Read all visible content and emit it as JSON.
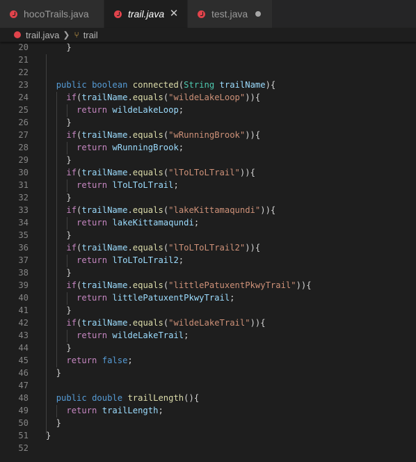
{
  "tabs": [
    {
      "label": "hocoTrails.java",
      "active": false,
      "state": "none"
    },
    {
      "label": "trail.java",
      "active": true,
      "state": "close"
    },
    {
      "label": "test.java",
      "active": false,
      "state": "dirty"
    }
  ],
  "breadcrumb": {
    "file": "trail.java",
    "symbol": "trail"
  },
  "colors": {
    "keyword": "#569cd6",
    "function": "#dcdcaa",
    "string": "#ce9178",
    "type": "#4ec9b0",
    "variable": "#9cdcfe",
    "control": "#c586c0",
    "text": "#d4d4d4",
    "line_number": "#858585",
    "java_icon": "#e0434b"
  },
  "lines": [
    {
      "n": "20",
      "tokens": [
        [
          "    }",
          ""
        ]
      ]
    },
    {
      "n": "21",
      "tokens": []
    },
    {
      "n": "22",
      "tokens": []
    },
    {
      "n": "23",
      "tokens": [
        [
          "  ",
          ""
        ],
        [
          "public",
          "k"
        ],
        [
          " ",
          ""
        ],
        [
          "boolean",
          "k"
        ],
        [
          " ",
          ""
        ],
        [
          "connected",
          "f"
        ],
        [
          "(",
          ""
        ],
        [
          "String",
          "t"
        ],
        [
          " ",
          ""
        ],
        [
          "trailName",
          "v"
        ],
        [
          "){",
          ""
        ]
      ]
    },
    {
      "n": "24",
      "tokens": [
        [
          "    ",
          ""
        ],
        [
          "if",
          "c"
        ],
        [
          "(",
          ""
        ],
        [
          "trailName",
          "v"
        ],
        [
          ".",
          ""
        ],
        [
          "equals",
          "f"
        ],
        [
          "(",
          ""
        ],
        [
          "\"wildeLakeLoop\"",
          "s"
        ],
        ")){"
      ]
    },
    {
      "n": "25",
      "tokens": [
        [
          "      ",
          ""
        ],
        [
          "return",
          "c"
        ],
        [
          " ",
          ""
        ],
        [
          "wildeLakeLoop",
          "v"
        ],
        [
          ";",
          ""
        ]
      ]
    },
    {
      "n": "26",
      "tokens": [
        [
          "    }",
          ""
        ]
      ]
    },
    {
      "n": "27",
      "tokens": [
        [
          "    ",
          ""
        ],
        [
          "if",
          "c"
        ],
        [
          "(",
          ""
        ],
        [
          "trailName",
          "v"
        ],
        [
          ".",
          ""
        ],
        [
          "equals",
          "f"
        ],
        [
          "(",
          ""
        ],
        [
          "\"wRunningBrook\"",
          "s"
        ],
        ")){"
      ]
    },
    {
      "n": "28",
      "tokens": [
        [
          "      ",
          ""
        ],
        [
          "return",
          "c"
        ],
        [
          " ",
          ""
        ],
        [
          "wRunningBrook",
          "v"
        ],
        [
          ";",
          ""
        ]
      ]
    },
    {
      "n": "29",
      "tokens": [
        [
          "    }",
          ""
        ]
      ]
    },
    {
      "n": "30",
      "tokens": [
        [
          "    ",
          ""
        ],
        [
          "if",
          "c"
        ],
        [
          "(",
          ""
        ],
        [
          "trailName",
          "v"
        ],
        [
          ".",
          ""
        ],
        [
          "equals",
          "f"
        ],
        [
          "(",
          ""
        ],
        [
          "\"lToLToLTrail\"",
          "s"
        ],
        ")){"
      ]
    },
    {
      "n": "31",
      "tokens": [
        [
          "      ",
          ""
        ],
        [
          "return",
          "c"
        ],
        [
          " ",
          ""
        ],
        [
          "lToLToLTrail",
          "v"
        ],
        [
          ";",
          ""
        ]
      ]
    },
    {
      "n": "32",
      "tokens": [
        [
          "    }",
          ""
        ]
      ]
    },
    {
      "n": "33",
      "tokens": [
        [
          "    ",
          ""
        ],
        [
          "if",
          "c"
        ],
        [
          "(",
          ""
        ],
        [
          "trailName",
          "v"
        ],
        [
          ".",
          ""
        ],
        [
          "equals",
          "f"
        ],
        [
          "(",
          ""
        ],
        [
          "\"lakeKittamaqundi\"",
          "s"
        ],
        ")){"
      ]
    },
    {
      "n": "34",
      "tokens": [
        [
          "      ",
          ""
        ],
        [
          "return",
          "c"
        ],
        [
          " ",
          ""
        ],
        [
          "lakeKittamaqundi",
          "v"
        ],
        [
          ";",
          ""
        ]
      ]
    },
    {
      "n": "35",
      "tokens": [
        [
          "    }",
          ""
        ]
      ]
    },
    {
      "n": "36",
      "tokens": [
        [
          "    ",
          ""
        ],
        [
          "if",
          "c"
        ],
        [
          "(",
          ""
        ],
        [
          "trailName",
          "v"
        ],
        [
          ".",
          ""
        ],
        [
          "equals",
          "f"
        ],
        [
          "(",
          ""
        ],
        [
          "\"lToLToLTrail2\"",
          "s"
        ],
        ")){"
      ]
    },
    {
      "n": "37",
      "tokens": [
        [
          "      ",
          ""
        ],
        [
          "return",
          "c"
        ],
        [
          " ",
          ""
        ],
        [
          "lToLToLTrail2",
          "v"
        ],
        [
          ";",
          ""
        ]
      ]
    },
    {
      "n": "38",
      "tokens": [
        [
          "    }",
          ""
        ]
      ]
    },
    {
      "n": "39",
      "tokens": [
        [
          "    ",
          ""
        ],
        [
          "if",
          "c"
        ],
        [
          "(",
          ""
        ],
        [
          "trailName",
          "v"
        ],
        [
          ".",
          ""
        ],
        [
          "equals",
          "f"
        ],
        [
          "(",
          ""
        ],
        [
          "\"littlePatuxentPkwyTrail\"",
          "s"
        ],
        ")){"
      ]
    },
    {
      "n": "40",
      "tokens": [
        [
          "      ",
          ""
        ],
        [
          "return",
          "c"
        ],
        [
          " ",
          ""
        ],
        [
          "littlePatuxentPkwyTrail",
          "v"
        ],
        [
          ";",
          ""
        ]
      ]
    },
    {
      "n": "41",
      "tokens": [
        [
          "    }",
          ""
        ]
      ]
    },
    {
      "n": "42",
      "tokens": [
        [
          "    ",
          ""
        ],
        [
          "if",
          "c"
        ],
        [
          "(",
          ""
        ],
        [
          "trailName",
          "v"
        ],
        [
          ".",
          ""
        ],
        [
          "equals",
          "f"
        ],
        [
          "(",
          ""
        ],
        [
          "\"wildeLakeTrail\"",
          "s"
        ],
        ")){"
      ]
    },
    {
      "n": "43",
      "tokens": [
        [
          "      ",
          ""
        ],
        [
          "return",
          "c"
        ],
        [
          " ",
          ""
        ],
        [
          "wildeLakeTrail",
          "v"
        ],
        [
          ";",
          ""
        ]
      ]
    },
    {
      "n": "44",
      "tokens": [
        [
          "    }",
          ""
        ]
      ]
    },
    {
      "n": "45",
      "tokens": [
        [
          "    ",
          ""
        ],
        [
          "return",
          "c"
        ],
        [
          " ",
          ""
        ],
        [
          "false",
          "k"
        ],
        [
          ";",
          ""
        ]
      ]
    },
    {
      "n": "46",
      "tokens": [
        [
          "  }",
          ""
        ]
      ]
    },
    {
      "n": "47",
      "tokens": []
    },
    {
      "n": "48",
      "tokens": [
        [
          "  ",
          ""
        ],
        [
          "public",
          "k"
        ],
        [
          " ",
          ""
        ],
        [
          "double",
          "k"
        ],
        [
          " ",
          ""
        ],
        [
          "trailLength",
          "f"
        ],
        [
          "(){",
          ""
        ]
      ]
    },
    {
      "n": "49",
      "tokens": [
        [
          "    ",
          ""
        ],
        [
          "return",
          "c"
        ],
        [
          " ",
          ""
        ],
        [
          "trailLength",
          "v"
        ],
        [
          ";",
          ""
        ]
      ]
    },
    {
      "n": "50",
      "tokens": [
        [
          "  }",
          ""
        ]
      ]
    },
    {
      "n": "51",
      "tokens": [
        [
          "}",
          ""
        ]
      ]
    },
    {
      "n": "52",
      "tokens": []
    }
  ]
}
